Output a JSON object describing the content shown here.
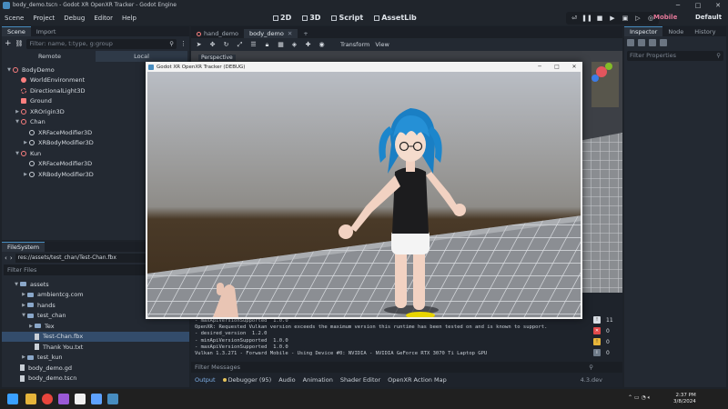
{
  "os": {
    "title": "body_demo.tscn - Godot XR OpenXR Tracker - Godot Engine",
    "controls": {
      "minimize": "─",
      "maximize": "□",
      "close": "✕"
    }
  },
  "menu": {
    "items": [
      "Scene",
      "Project",
      "Debug",
      "Editor",
      "Help"
    ],
    "workspaces": [
      "2D",
      "3D",
      "Script",
      "AssetLib"
    ],
    "renderer": "Mobile",
    "layout": "Default"
  },
  "scene_dock": {
    "tabs": [
      "Scene",
      "Import"
    ],
    "filter_placeholder": "Filter: name, t:type, g:group",
    "remote_label": "Remote",
    "local_label": "Local",
    "nodes": [
      {
        "label": "BodyDemo",
        "depth": 0,
        "arrow": "▼",
        "kind": "3d"
      },
      {
        "label": "WorldEnvironment",
        "depth": 1,
        "arrow": "",
        "kind": "env"
      },
      {
        "label": "DirectionalLight3D",
        "depth": 1,
        "arrow": "",
        "kind": "light"
      },
      {
        "label": "Ground",
        "depth": 1,
        "arrow": "",
        "kind": "mesh"
      },
      {
        "label": "XROrigin3D",
        "depth": 1,
        "arrow": "▶",
        "kind": "3d"
      },
      {
        "label": "Chan",
        "depth": 1,
        "arrow": "▼",
        "kind": "3d"
      },
      {
        "label": "XRFaceModifier3D",
        "depth": 2,
        "arrow": "",
        "kind": "plain"
      },
      {
        "label": "XRBodyModifier3D",
        "depth": 2,
        "arrow": "▶",
        "kind": "plain"
      },
      {
        "label": "Kun",
        "depth": 1,
        "arrow": "▼",
        "kind": "3d"
      },
      {
        "label": "XRFaceModifier3D",
        "depth": 2,
        "arrow": "",
        "kind": "plain"
      },
      {
        "label": "XRBodyModifier3D",
        "depth": 2,
        "arrow": "▶",
        "kind": "plain"
      }
    ]
  },
  "filesystem": {
    "tab": "FileSystem",
    "path": "res://assets/test_chan/Test-Chan.fbx",
    "filter_label": "Filter Files",
    "items": [
      {
        "label": "assets",
        "depth": 1,
        "type": "folder",
        "arrow": "▼"
      },
      {
        "label": "ambientcg.com",
        "depth": 2,
        "type": "folder",
        "arrow": "▶"
      },
      {
        "label": "hands",
        "depth": 2,
        "type": "folder",
        "arrow": "▶"
      },
      {
        "label": "test_chan",
        "depth": 2,
        "type": "folder",
        "arrow": "▼"
      },
      {
        "label": "Tex",
        "depth": 3,
        "type": "folder",
        "arrow": "▶"
      },
      {
        "label": "Test-Chan.fbx",
        "depth": 3,
        "type": "file",
        "arrow": "",
        "selected": true
      },
      {
        "label": "Thank You.txt",
        "depth": 3,
        "type": "file",
        "arrow": ""
      },
      {
        "label": "test_kun",
        "depth": 2,
        "type": "folder",
        "arrow": "▶"
      },
      {
        "label": "body_demo.gd",
        "depth": 1,
        "type": "file",
        "arrow": ""
      },
      {
        "label": "body_demo.tscn",
        "depth": 1,
        "type": "file",
        "arrow": ""
      }
    ]
  },
  "editor": {
    "scene_tabs": [
      "hand_demo",
      "body_demo"
    ],
    "add_tab": "+",
    "toolbar_labels": [
      "Transform",
      "View"
    ],
    "perspective_label": "Perspective"
  },
  "tracker_window": {
    "title": "Godot XR OpenXR Tracker (DEBUG)",
    "controls": {
      "minimize": "─",
      "maximize": "□",
      "close": "✕"
    }
  },
  "output": {
    "lines": [
      "- maxApiVersionSupported  1.0.0",
      "OpenXR: Requested Vulkan version exceeds the maximum version this runtime has been tested on and is known to support.",
      "- desired_version  1.2.0",
      "- minApiVersionSupported  1.0.0",
      "- maxApiVersionSupported  1.0.0",
      "Vulkan 1.3.271 - Forward Mobile - Using Device #0: NVIDIA - NVIDIA GeForce RTX 3070 Ti Laptop GPU"
    ],
    "filter_placeholder": "Filter Messages",
    "tabs": [
      "Output",
      "Debugger (95)",
      "Audio",
      "Animation",
      "Shader Editor",
      "OpenXR Action Map"
    ],
    "version": "4.3.dev",
    "counts": {
      "errors": "0",
      "warnings": "0",
      "info": "11",
      "messages": "0"
    }
  },
  "inspector": {
    "tabs": [
      "Inspector",
      "Node",
      "History"
    ],
    "filter_placeholder": "Filter Properties"
  },
  "taskbar": {
    "time": "2:37 PM",
    "date": "3/8/2024"
  },
  "colors": {
    "accent": "#478cbf",
    "node3d": "#fc7f7f",
    "renderer": "#e5799a",
    "selection": "#334c6b"
  }
}
